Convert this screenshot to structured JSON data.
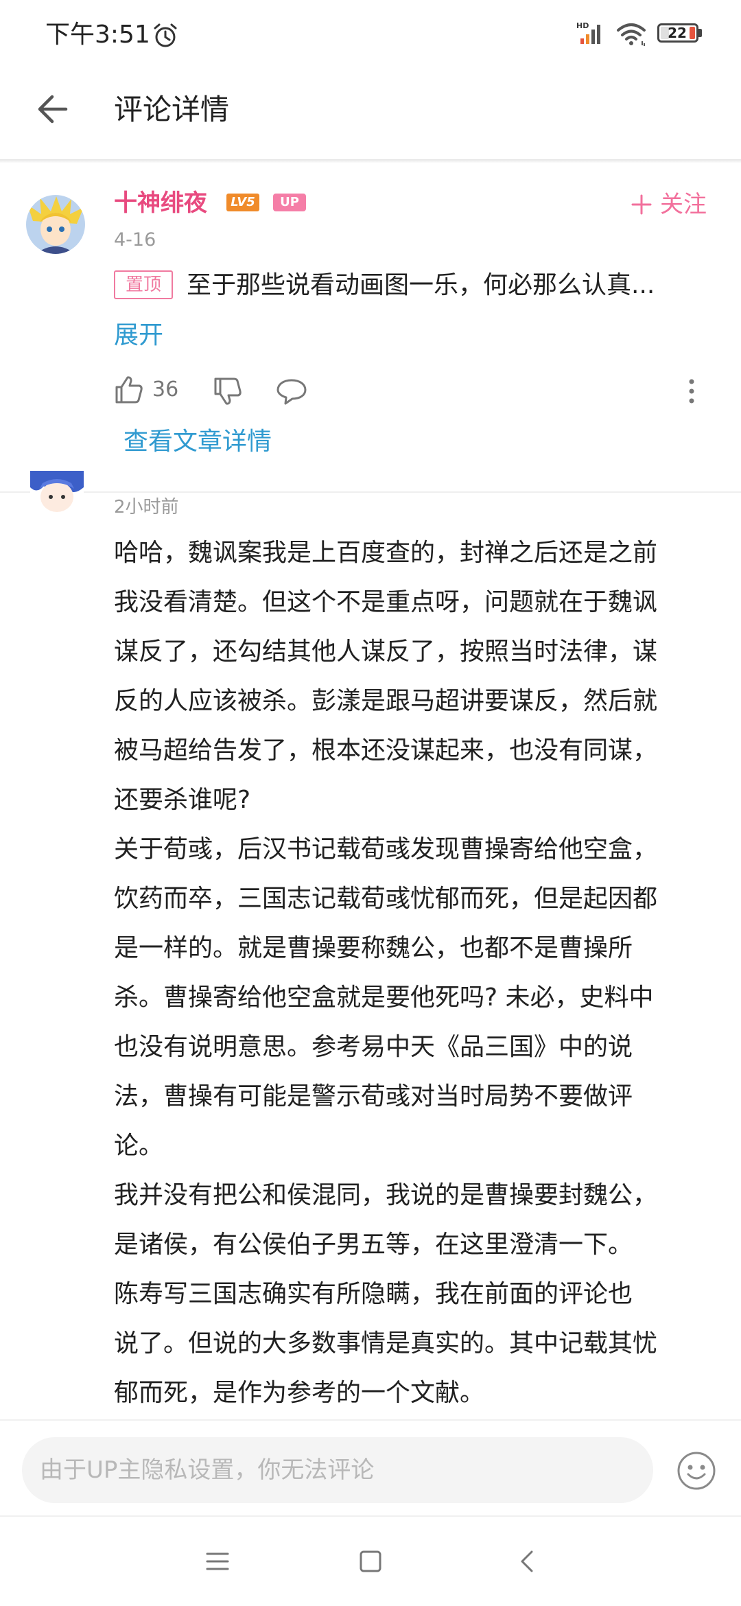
{
  "status_bar": {
    "time": "下午3:51",
    "battery": "22",
    "network_label": "HD"
  },
  "header": {
    "title": "评论详情"
  },
  "comment": {
    "username": "十神绯夜",
    "level_badge": "LV5",
    "up_badge": "UP",
    "follow_label": "关注",
    "date": "4-16",
    "pinned_label": "置顶",
    "text": "至于那些说看动画图一乐，何必那么认真...",
    "expand_label": "展开",
    "like_count": "36",
    "article_link": "查看文章详情"
  },
  "reply": {
    "time": "2小时前",
    "lines": [
      "哈哈，魏讽案我是上百度查的，封禅之后还是之前",
      "我没看清楚。但这个不是重点呀，问题就在于魏讽",
      "谋反了，还勾结其他人谋反了，按照当时法律，谋",
      "反的人应该被杀。彭漾是跟马超讲要谋反，然后就",
      "被马超给告发了，根本还没谋起来，也没有同谋，",
      "还要杀谁呢?",
      "关于荀彧，后汉书记载荀彧发现曹操寄给他空盒，",
      "饮药而卒，三国志记载荀彧忧郁而死，但是起因都",
      "是一样的。就是曹操要称魏公，也都不是曹操所",
      "杀。曹操寄给他空盒就是要他死吗? 未必，史料中",
      "也没有说明意思。参考易中天《品三国》中的说",
      "法，曹操有可能是警示荀彧对当时局势不要做评",
      "论。",
      "我并没有把公和侯混同，我说的是曹操要封魏公，",
      "是诸侯，有公侯伯子男五等，在这里澄清一下。",
      "陈寿写三国志确实有所隐瞒，我在前面的评论也",
      "说了。但说的大多数事情是真实的。其中记载其忧",
      "郁而死，是作为参考的一个文献。"
    ]
  },
  "input": {
    "placeholder": "由于UP主隐私设置，你无法评论"
  },
  "colors": {
    "username": "#e84a7f",
    "link": "#2f9ad0",
    "follow": "#f2709c"
  }
}
